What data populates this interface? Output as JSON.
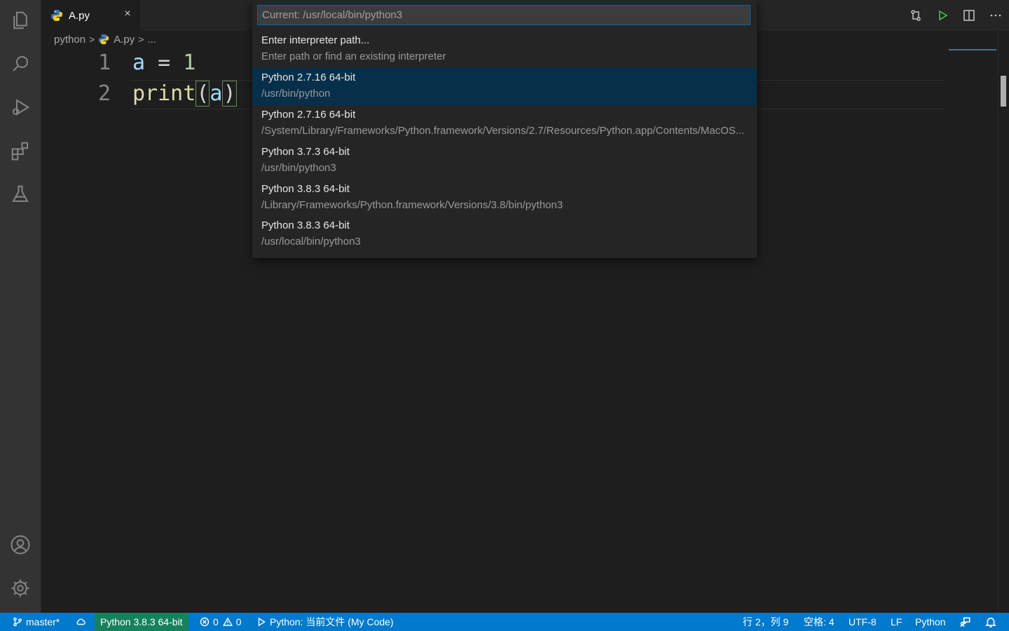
{
  "tab": {
    "label": "A.py",
    "close": "×"
  },
  "breadcrumb": {
    "folder": "python",
    "file": "A.py",
    "more": "..."
  },
  "editor": {
    "lines": [
      {
        "num": "1",
        "code": "a = 1"
      },
      {
        "num": "2",
        "code": "print(a)"
      }
    ]
  },
  "quick_pick": {
    "input_placeholder": "Current: /usr/local/bin/python3",
    "items": [
      {
        "label": "Enter interpreter path...",
        "description": "Enter path or find an existing interpreter"
      },
      {
        "label": "Python 2.7.16 64-bit",
        "description": "/usr/bin/python"
      },
      {
        "label": "Python 2.7.16 64-bit",
        "description": "/System/Library/Frameworks/Python.framework/Versions/2.7/Resources/Python.app/Contents/MacOS..."
      },
      {
        "label": "Python 3.7.3 64-bit",
        "description": "/usr/bin/python3"
      },
      {
        "label": "Python 3.8.3 64-bit",
        "description": "/Library/Frameworks/Python.framework/Versions/3.8/bin/python3"
      },
      {
        "label": "Python 3.8.3 64-bit",
        "description": "/usr/local/bin/python3"
      }
    ],
    "selected_index": 1
  },
  "status_bar": {
    "branch": "master*",
    "interpreter": "Python 3.8.3 64-bit",
    "errors": "0",
    "warnings": "0",
    "run_config": "Python: 当前文件 (My Code)",
    "position": "行 2，列 9",
    "indent": "空格: 4",
    "encoding": "UTF-8",
    "eol": "LF",
    "language": "Python"
  },
  "colors": {
    "status_bar": "#007acc",
    "selection": "#062f4a",
    "accent_green": "#4ec94e"
  }
}
